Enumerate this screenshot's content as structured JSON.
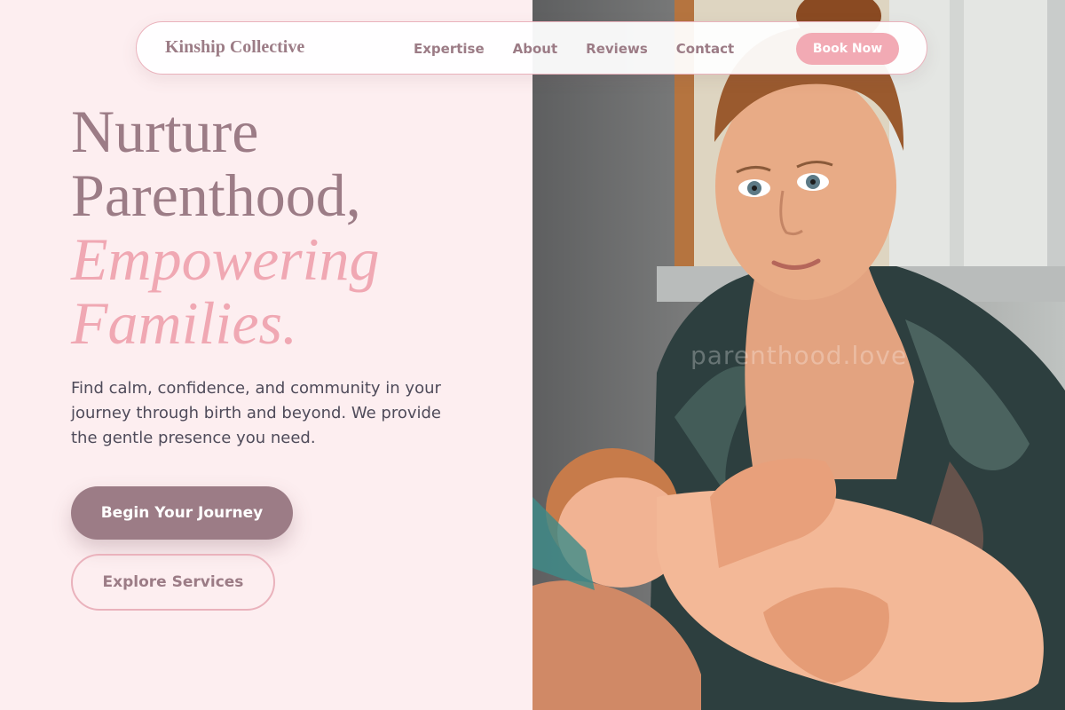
{
  "nav": {
    "brand": "Kinship Collective",
    "links": [
      "Expertise",
      "About",
      "Reviews",
      "Contact"
    ],
    "cta": "Book Now"
  },
  "hero": {
    "title_line1": "Nurture",
    "title_line2": "Parenthood,",
    "accent_line1": "Empowering",
    "accent_line2": "Families.",
    "subtitle": "Find calm, confidence, and community in your journey through birth and beyond. We provide the gentle presence you need.",
    "primary_cta": "Begin Your Journey",
    "secondary_cta": "Explore Services"
  },
  "image": {
    "watermark": "parenthood.love"
  },
  "colors": {
    "background": "#fdeef0",
    "brand": "#9c7c86",
    "accent": "#f0a8b3",
    "text": "#4f4b5a"
  }
}
